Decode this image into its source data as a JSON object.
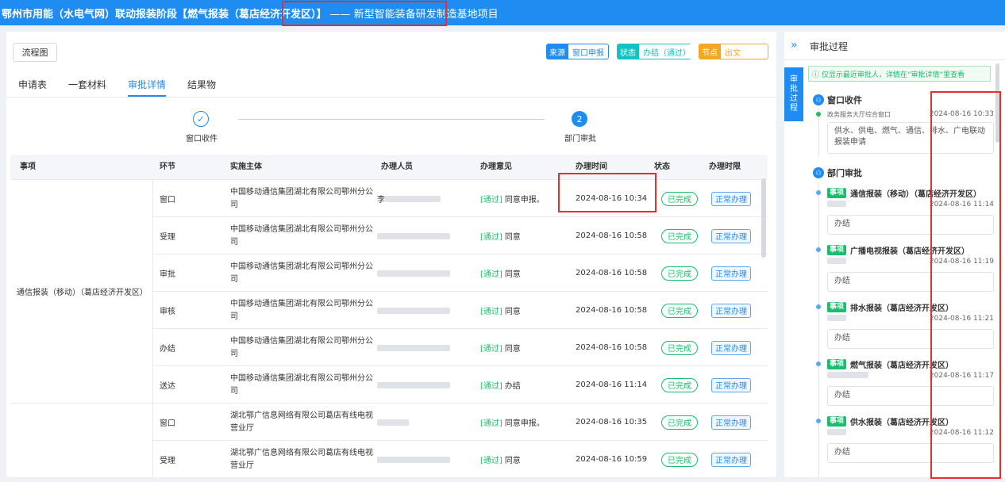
{
  "topbar": {
    "title": "鄂州市用能（水电气网）联动报装阶段【燃气报装（葛店经济开发区）】",
    "project": "—— 新型智能装备研发制造基地项目"
  },
  "main": {
    "flow_button": "流程图",
    "tags": {
      "source_key": "来源",
      "source_val": "窗口申报",
      "status_key": "状态",
      "status_val": "办结（通过）",
      "node_key": "节点",
      "node_val": "出文"
    },
    "tabs": [
      "申请表",
      "一套材料",
      "审批详情",
      "结果物"
    ],
    "active_tab": 2,
    "steps": [
      {
        "mark": "✓",
        "label": "窗口收件"
      },
      {
        "mark": "2",
        "label": "部门审批"
      }
    ],
    "table": {
      "headers": [
        "事项",
        "环节",
        "实施主体",
        "办理人员",
        "办理意见",
        "办理时间",
        "状态",
        "办理时限"
      ],
      "groups": [
        {
          "name": "通信报装（移动）（葛店经济开发区）",
          "rows": [
            {
              "node": "窗口",
              "subject": "中国移动通信集团湖北有限公司鄂州分公司",
              "user": "李",
              "opinion_tag": "[通过]",
              "opinion": "同意申报。",
              "time": "2024-08-16 10:34",
              "status": "已完成",
              "limit": "正常办理"
            },
            {
              "node": "受理",
              "subject": "中国移动通信集团湖北有限公司鄂州分公司",
              "user": "",
              "opinion_tag": "[通过]",
              "opinion": "同意",
              "time": "2024-08-16 10:58",
              "status": "已完成",
              "limit": "正常办理"
            },
            {
              "node": "审批",
              "subject": "中国移动通信集团湖北有限公司鄂州分公司",
              "user": "",
              "opinion_tag": "[通过]",
              "opinion": "同意",
              "time": "2024-08-16 10:58",
              "status": "已完成",
              "limit": "正常办理"
            },
            {
              "node": "审核",
              "subject": "中国移动通信集团湖北有限公司鄂州分公司",
              "user": "",
              "opinion_tag": "[通过]",
              "opinion": "同意",
              "time": "2024-08-16 10:58",
              "status": "已完成",
              "limit": "正常办理"
            },
            {
              "node": "办结",
              "subject": "中国移动通信集团湖北有限公司鄂州分公司",
              "user": "",
              "opinion_tag": "[通过]",
              "opinion": "同意",
              "time": "2024-08-16 10:58",
              "status": "已完成",
              "limit": "正常办理"
            },
            {
              "node": "送达",
              "subject": "中国移动通信集团湖北有限公司鄂州分公司",
              "user": "",
              "opinion_tag": "[通过]",
              "opinion": "办结",
              "time": "2024-08-16 11:14",
              "status": "已完成",
              "limit": "正常办理"
            }
          ]
        },
        {
          "name": "",
          "rows": [
            {
              "node": "窗口",
              "subject": "湖北鄂广信息网络有限公司葛店有线电视营业厅",
              "user": "",
              "opinion_tag": "[通过]",
              "opinion": "同意申报。",
              "time": "2024-08-16 10:35",
              "status": "已完成",
              "limit": "正常办理"
            },
            {
              "node": "受理",
              "subject": "湖北鄂广信息网络有限公司葛店有线电视营业厅",
              "user": "",
              "opinion_tag": "[通过]",
              "opinion": "同意",
              "time": "2024-08-16 10:59",
              "status": "已完成",
              "limit": "正常办理"
            }
          ]
        }
      ]
    }
  },
  "right": {
    "toggle": "»",
    "title": "审批过程",
    "vtab": [
      "审",
      "批",
      "过",
      "程"
    ],
    "notice": "ⓘ 仅显示最近审批人，详情在“审批详情”里查看",
    "window_section": "窗口收件",
    "window_dept": "政务服务大厅综合窗口",
    "window_time": "2024-08-16 10:33",
    "window_text": "供水、供电、燃气、通信、排水、广电联动报装申请",
    "dept_section": "部门审批",
    "item_tag": "事项",
    "items": [
      {
        "name": "通信报装（移动）（葛店经济开发区）",
        "time": "2024-08-16 11:14",
        "result": "办结"
      },
      {
        "name": "广播电视报装（葛店经济开发区）",
        "time": "2024-08-16 11:19",
        "result": "办结"
      },
      {
        "name": "排水报装（葛店经济开发区）",
        "time": "2024-08-16 11:21",
        "result": "办结"
      },
      {
        "name": "燃气报装（葛店经济开发区）",
        "time": "2024-08-16 11:17",
        "result": "办结"
      },
      {
        "name": "供水报装（葛店经济开发区）",
        "time": "2024-08-16 11:12",
        "result": "办结"
      }
    ]
  }
}
